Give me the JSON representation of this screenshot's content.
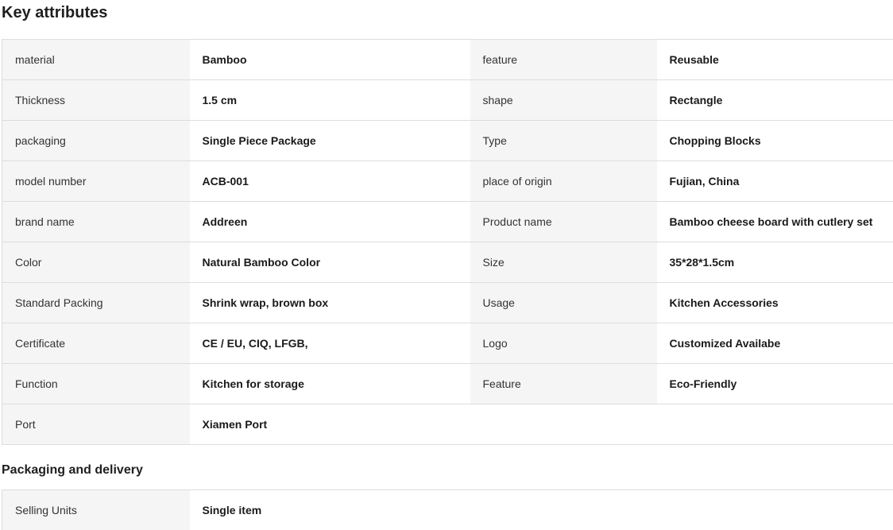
{
  "key_attributes": {
    "title": "Key attributes",
    "rows": [
      {
        "l1": "material",
        "v1": "Bamboo",
        "l2": "feature",
        "v2": "Reusable"
      },
      {
        "l1": "Thickness",
        "v1": "1.5 cm",
        "l2": "shape",
        "v2": "Rectangle"
      },
      {
        "l1": "packaging",
        "v1": "Single Piece Package",
        "l2": "Type",
        "v2": "Chopping Blocks"
      },
      {
        "l1": "model number",
        "v1": "ACB-001",
        "l2": "place of origin",
        "v2": "Fujian, China"
      },
      {
        "l1": "brand name",
        "v1": "Addreen",
        "l2": "Product name",
        "v2": "Bamboo cheese board with cutlery set"
      },
      {
        "l1": "Color",
        "v1": "Natural Bamboo Color",
        "l2": "Size",
        "v2": "35*28*1.5cm"
      },
      {
        "l1": "Standard Packing",
        "v1": "Shrink wrap, brown box",
        "l2": "Usage",
        "v2": "Kitchen Accessories"
      },
      {
        "l1": "Certificate",
        "v1": "CE / EU, CIQ, LFGB,",
        "l2": "Logo",
        "v2": "Customized Availabe"
      },
      {
        "l1": "Function",
        "v1": "Kitchen for storage",
        "l2": "Feature",
        "v2": "Eco-Friendly"
      },
      {
        "l1": "Port",
        "v1": "Xiamen Port",
        "l2": "",
        "v2": ""
      }
    ]
  },
  "packaging_delivery": {
    "title": "Packaging and delivery",
    "rows": [
      {
        "l1": "Selling Units",
        "v1": "Single item"
      }
    ]
  },
  "colors": {
    "label_bg": "#f5f5f5",
    "border": "#dddddd",
    "text": "#222222"
  }
}
